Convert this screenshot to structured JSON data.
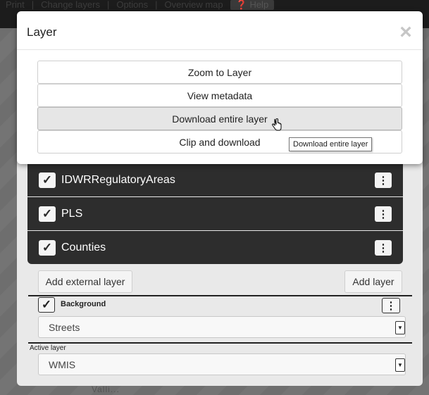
{
  "toolbar": {
    "items": [
      "Print",
      "Change layers",
      "Options",
      "Overview map"
    ],
    "help": "Help"
  },
  "map": {
    "label": "Valli..."
  },
  "modal": {
    "title": "Layer",
    "close": "×",
    "actions": [
      "Zoom to Layer",
      "View metadata",
      "Download entire layer",
      "Clip and download"
    ],
    "hovered": "Download entire layer",
    "tooltip": "Download entire layer"
  },
  "layers": {
    "rows": [
      {
        "name": "IDWRRegulatoryAreas",
        "checked": true
      },
      {
        "name": "PLS",
        "checked": true
      },
      {
        "name": "Counties",
        "checked": true
      }
    ],
    "menu_glyph": "⋮",
    "check_glyph": "✓"
  },
  "buttons": {
    "add_external": "Add external layer",
    "add_layer": "Add layer"
  },
  "background": {
    "label": "Background",
    "selected": "Streets",
    "checked": true
  },
  "active_layer": {
    "label": "Active layer",
    "selected": "WMIS"
  },
  "icons": {
    "close": "close-icon",
    "menu": "kebab-menu-icon",
    "check": "checkmark-icon",
    "dropdown": "dropdown-arrow-icon",
    "cursor": "hand-pointer-icon",
    "help": "help-icon"
  },
  "colors": {
    "dark_row": "#2d2d2d",
    "panel": "#e9e9e9",
    "toolbar": "#1c1c1c",
    "hover_button": "#e6e6e6"
  }
}
